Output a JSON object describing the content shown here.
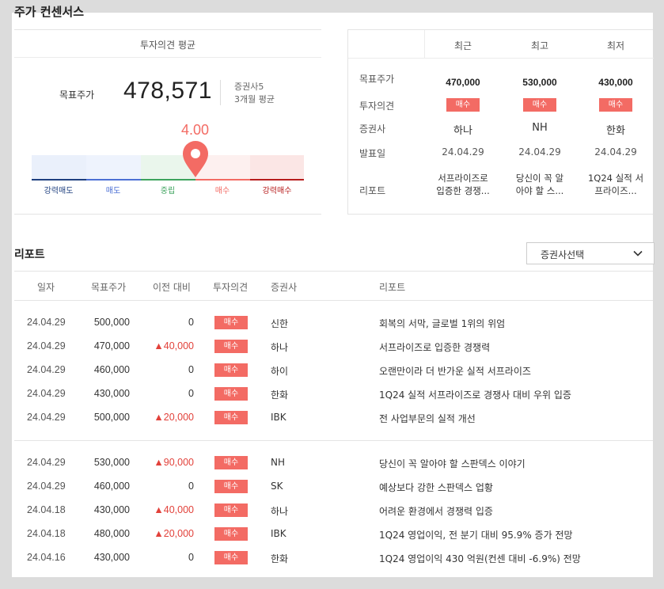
{
  "page": {
    "title": "주가 컨센서스"
  },
  "summary": {
    "header": "투자의견 평균",
    "target_label": "목표주가",
    "target_value": "478,571",
    "broker_count": "증권사5",
    "period": "3개월 평균",
    "score": "4.00",
    "scale_labels": [
      "강력매도",
      "매도",
      "중립",
      "매수",
      "강력매수"
    ],
    "scale_colors": [
      "#1e3f7f",
      "#4b6fd4",
      "#3da35d",
      "#f36b64",
      "#b71c1c"
    ]
  },
  "latest": {
    "columns": [
      "최근",
      "최고",
      "최저"
    ],
    "row_labels": [
      "목표주가",
      "투자의견",
      "증권사",
      "발표일",
      "리포트"
    ],
    "items": [
      {
        "price": "470,000",
        "opinion": "매수",
        "broker": "하나",
        "date": "24.04.29",
        "report_line1": "서프라이즈로",
        "report_line2": "입증한 경쟁..."
      },
      {
        "price": "530,000",
        "opinion": "매수",
        "broker": "NH",
        "date": "24.04.29",
        "report_line1": "당신이 꼭 알",
        "report_line2": "아야 할 스..."
      },
      {
        "price": "430,000",
        "opinion": "매수",
        "broker": "한화",
        "date": "24.04.29",
        "report_line1": "1Q24 실적 서",
        "report_line2": "프라이즈..."
      }
    ]
  },
  "reports": {
    "title": "리포트",
    "select_label": "증권사선택",
    "headers": [
      "일자",
      "목표주가",
      "이전 대비",
      "투자의견",
      "증권사",
      "리포트"
    ],
    "rows": [
      {
        "date": "24.04.29",
        "target": "500,000",
        "change": "0",
        "up": false,
        "opinion": "매수",
        "broker": "신한",
        "title": "회복의 서막, 글로벌 1위의 위엄"
      },
      {
        "date": "24.04.29",
        "target": "470,000",
        "change": "▲40,000",
        "up": true,
        "opinion": "매수",
        "broker": "하나",
        "title": "서프라이즈로 입증한 경쟁력"
      },
      {
        "date": "24.04.29",
        "target": "460,000",
        "change": "0",
        "up": false,
        "opinion": "매수",
        "broker": "하이",
        "title": "오랜만이라 더 반가운 실적 서프라이즈"
      },
      {
        "date": "24.04.29",
        "target": "430,000",
        "change": "0",
        "up": false,
        "opinion": "매수",
        "broker": "한화",
        "title": "1Q24 실적 서프라이즈로 경쟁사 대비 우위 입증"
      },
      {
        "date": "24.04.29",
        "target": "500,000",
        "change": "▲20,000",
        "up": true,
        "opinion": "매수",
        "broker": "IBK",
        "title": "전 사업부문의 실적 개선"
      },
      {
        "date": "24.04.29",
        "target": "530,000",
        "change": "▲90,000",
        "up": true,
        "opinion": "매수",
        "broker": "NH",
        "title": "당신이 꼭 알아야 할 스판덱스 이야기"
      },
      {
        "date": "24.04.29",
        "target": "460,000",
        "change": "0",
        "up": false,
        "opinion": "매수",
        "broker": "SK",
        "title": "예상보다 강한 스판덱스 업황"
      },
      {
        "date": "24.04.18",
        "target": "430,000",
        "change": "▲40,000",
        "up": true,
        "opinion": "매수",
        "broker": "하나",
        "title": "어려운 환경에서 경쟁력 입증"
      },
      {
        "date": "24.04.18",
        "target": "480,000",
        "change": "▲20,000",
        "up": true,
        "opinion": "매수",
        "broker": "IBK",
        "title": "1Q24 영업이익, 전 분기 대비 95.9% 증가 전망"
      },
      {
        "date": "24.04.16",
        "target": "430,000",
        "change": "0",
        "up": false,
        "opinion": "매수",
        "broker": "한화",
        "title": "1Q24 영업이익 430 억원(컨센 대비 -6.9%) 전망"
      }
    ]
  }
}
